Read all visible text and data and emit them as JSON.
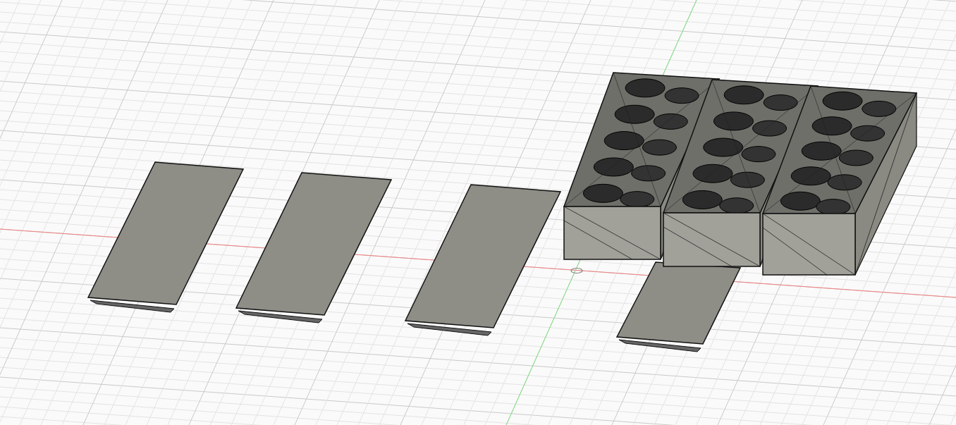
{
  "viewport": {
    "objects": [
      {
        "kind": "plate"
      },
      {
        "kind": "plate"
      },
      {
        "kind": "plate"
      },
      {
        "kind": "plate"
      },
      {
        "kind": "block"
      },
      {
        "kind": "block"
      },
      {
        "kind": "block"
      }
    ]
  }
}
